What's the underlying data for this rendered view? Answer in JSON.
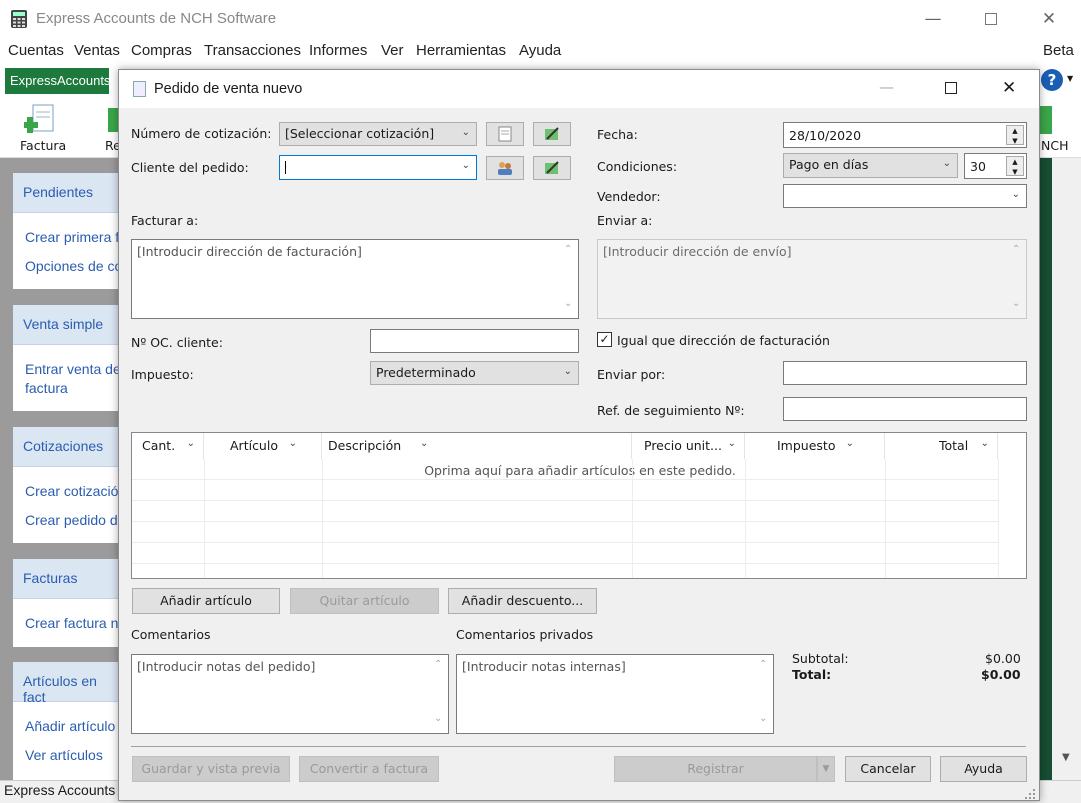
{
  "app": {
    "title": "Express Accounts de NCH Software",
    "menu": [
      "Cuentas",
      "Ventas",
      "Compras",
      "Transacciones",
      "Informes",
      "Ver",
      "Herramientas",
      "Ayuda"
    ],
    "menu_right": "Beta",
    "tab_label": "ExpressAccounts",
    "toolbar": {
      "factura": "Factura",
      "re": "Re",
      "nch": "NCH"
    },
    "status_text": "Express Accounts"
  },
  "sidebar": {
    "sections": [
      {
        "title": "Pendientes",
        "links": [
          "Crear primera f",
          "Opciones de co"
        ]
      },
      {
        "title": "Venta simple",
        "links": [
          "Entrar venta de",
          "factura"
        ]
      },
      {
        "title": "Cotizaciones",
        "links": [
          "Crear cotización",
          "Crear pedido de"
        ]
      },
      {
        "title": "Facturas",
        "links": [
          "Crear factura nu"
        ]
      },
      {
        "title": "Artículos en fact",
        "links": [
          "Añadir artículo",
          "Ver artículos"
        ]
      }
    ]
  },
  "dialog": {
    "title": "Pedido de venta nuevo",
    "left": {
      "quote_label": "Número de cotización:",
      "quote_value": "[Seleccionar cotización]",
      "customer_label": "Cliente del pedido:",
      "customer_value": "",
      "bill_to_label": "Facturar a:",
      "bill_to_placeholder": "[Introducir dirección de facturación]",
      "po_label": "Nº OC. cliente:",
      "po_value": "",
      "tax_label": "Impuesto:",
      "tax_value": "Predeterminado"
    },
    "right": {
      "date_label": "Fecha:",
      "date_value": "28/10/2020",
      "terms_label": "Condiciones:",
      "terms_value": "Pago en días",
      "terms_days": "30",
      "seller_label": "Vendedor:",
      "seller_value": "",
      "ship_to_label": "Enviar a:",
      "ship_to_placeholder": "[Introducir dirección de envío]",
      "same_address_label": "Igual que dirección de facturación",
      "same_address_checked": true,
      "ship_by_label": "Enviar por:",
      "ship_by_value": "",
      "tracking_label": "Ref. de seguimiento Nº:",
      "tracking_value": ""
    },
    "grid": {
      "columns": [
        "Cant.",
        "Artículo",
        "Descripción",
        "Precio unit...",
        "Impuesto",
        "Total"
      ],
      "empty_hint": "Oprima aquí para añadir artículos en este pedido."
    },
    "item_buttons": {
      "add": "Añadir artículo",
      "remove": "Quitar artículo",
      "discount": "Añadir descuento..."
    },
    "comments": {
      "label": "Comentarios",
      "placeholder": "[Introducir notas del pedido]",
      "private_label": "Comentarios privados",
      "private_placeholder": "[Introducir notas internas]"
    },
    "totals": {
      "subtotal_label": "Subtotal:",
      "subtotal_value": "$0.00",
      "total_label": "Total:",
      "total_value": "$0.00"
    },
    "footer": {
      "save_preview": "Guardar y vista previa",
      "convert": "Convertir a factura",
      "register": "Registrar",
      "cancel": "Cancelar",
      "help": "Ayuda"
    }
  }
}
